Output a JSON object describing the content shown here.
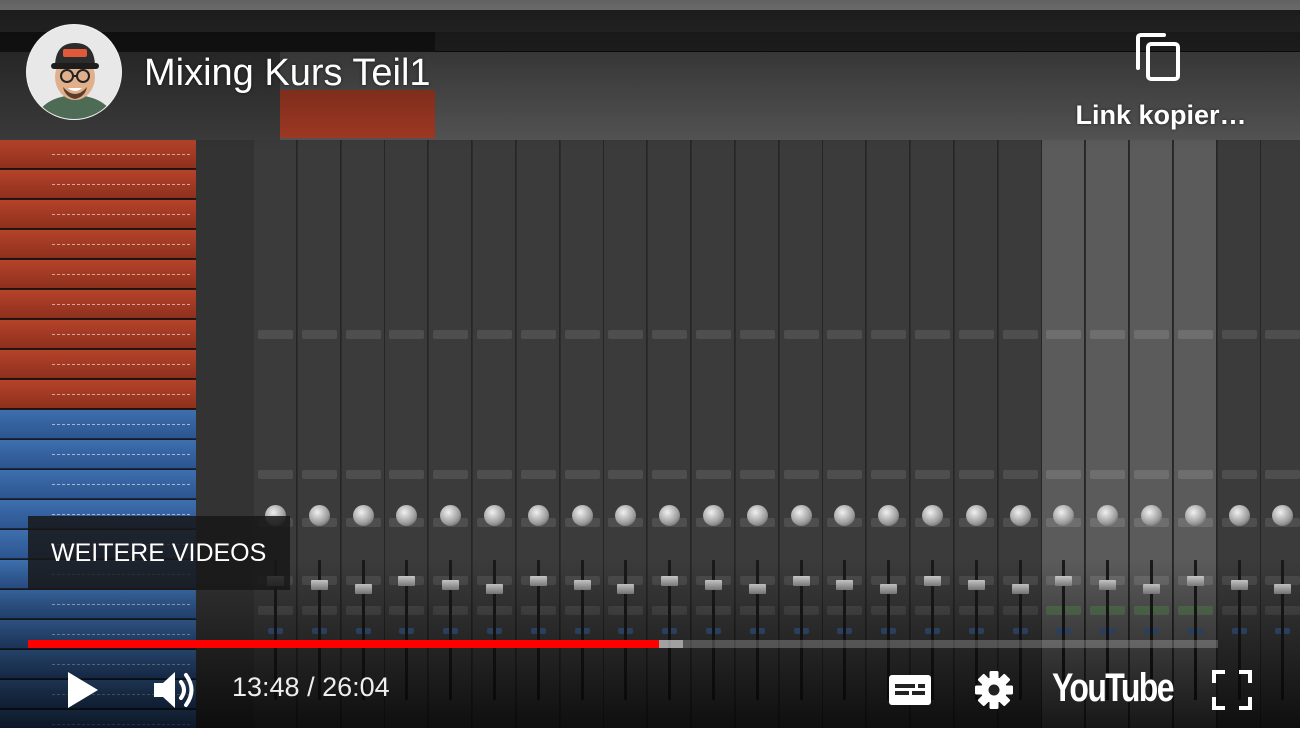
{
  "video": {
    "title": "Mixing Kurs Teil1",
    "copy_link_label": "Link kopier…",
    "more_videos_label": "WEITERE VIDEOS",
    "time_display": "13:48 / 26:04",
    "current_time": "13:48",
    "duration": "26:04",
    "progress_fraction": 0.53,
    "buffer_fraction": 0.55,
    "logo_text": "YouTube"
  },
  "icons": {
    "avatar": "channel-avatar",
    "copy": "copy-link-icon",
    "play": "play-icon",
    "volume": "volume-icon",
    "subtitles": "subtitles-icon",
    "settings": "gear-icon",
    "fullscreen": "fullscreen-icon"
  },
  "colors": {
    "progress_played": "#ff0000",
    "text": "#ffffff",
    "control_bg": "#000000"
  }
}
